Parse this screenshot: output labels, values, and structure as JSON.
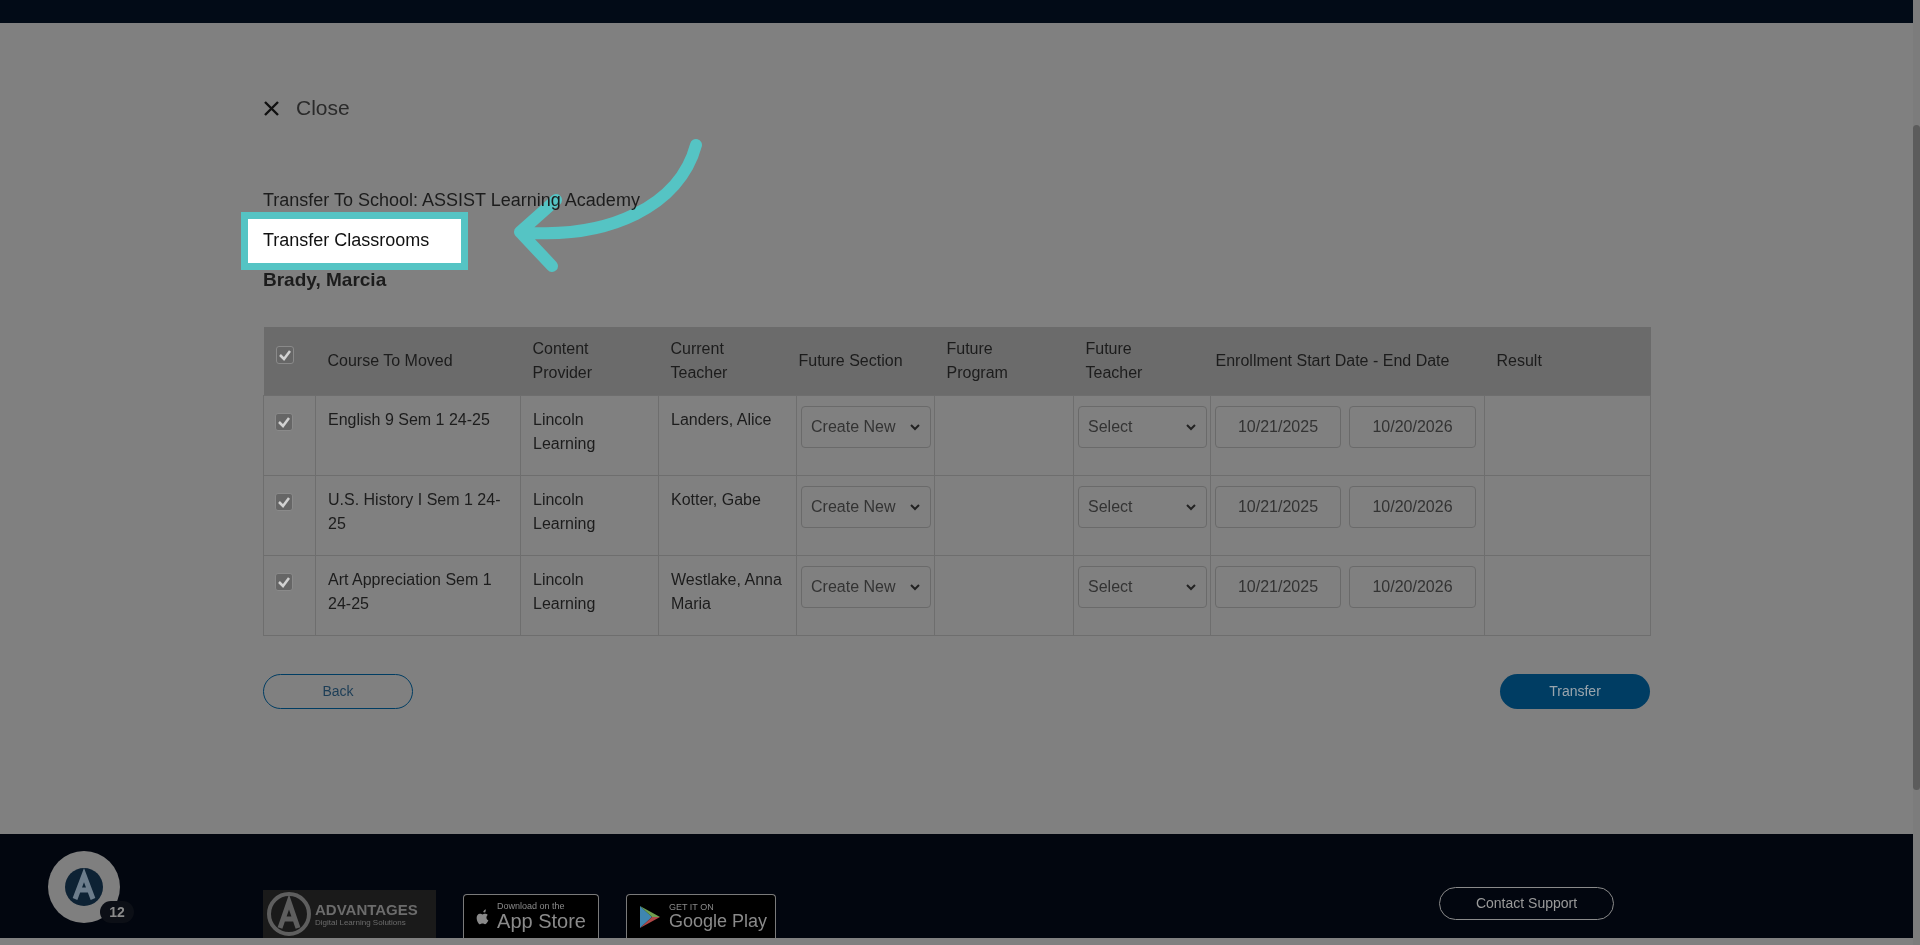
{
  "close": {
    "label": "Close"
  },
  "transfer_to": "Transfer To School: ASSIST Learning Academy",
  "highlight": {
    "label": "Transfer Classrooms"
  },
  "student_name": "Brady, Marcia",
  "table": {
    "select_all_checked": true,
    "columns": [
      "Course To Moved",
      "Content Provider",
      "Current Teacher",
      "Future Section",
      "Future Program",
      "Future Teacher",
      "Enrollment Start Date - End Date",
      "Result"
    ],
    "rows": [
      {
        "checked": true,
        "course": "English 9 Sem 1 24-25",
        "provider": "Lincoln Learning",
        "teacher": "Landers, Alice",
        "future_section": "Create New",
        "future_teacher": "Select",
        "start_date": "10/21/2025",
        "end_date": "10/20/2026"
      },
      {
        "checked": true,
        "course": "U.S. History I Sem 1 24-25",
        "provider": "Lincoln Learning",
        "teacher": "Kotter, Gabe",
        "future_section": "Create New",
        "future_teacher": "Select",
        "start_date": "10/21/2025",
        "end_date": "10/20/2026"
      },
      {
        "checked": true,
        "course": "Art Appreciation Sem 1 24-25",
        "provider": "Lincoln Learning",
        "teacher": "Westlake, Anna Maria",
        "future_section": "Create New",
        "future_teacher": "Select",
        "start_date": "10/21/2025",
        "end_date": "10/20/2026"
      }
    ]
  },
  "buttons": {
    "back": "Back",
    "transfer": "Transfer"
  },
  "footer": {
    "badge": "12",
    "logo_name": "ADVANTAGES",
    "logo_tagline": "Digital Learning Solutions",
    "app_store": {
      "small": "Download on the",
      "big": "App Store"
    },
    "google_play": {
      "small": "GET IT ON",
      "big": "Google Play"
    },
    "contact": "Contact Support"
  }
}
